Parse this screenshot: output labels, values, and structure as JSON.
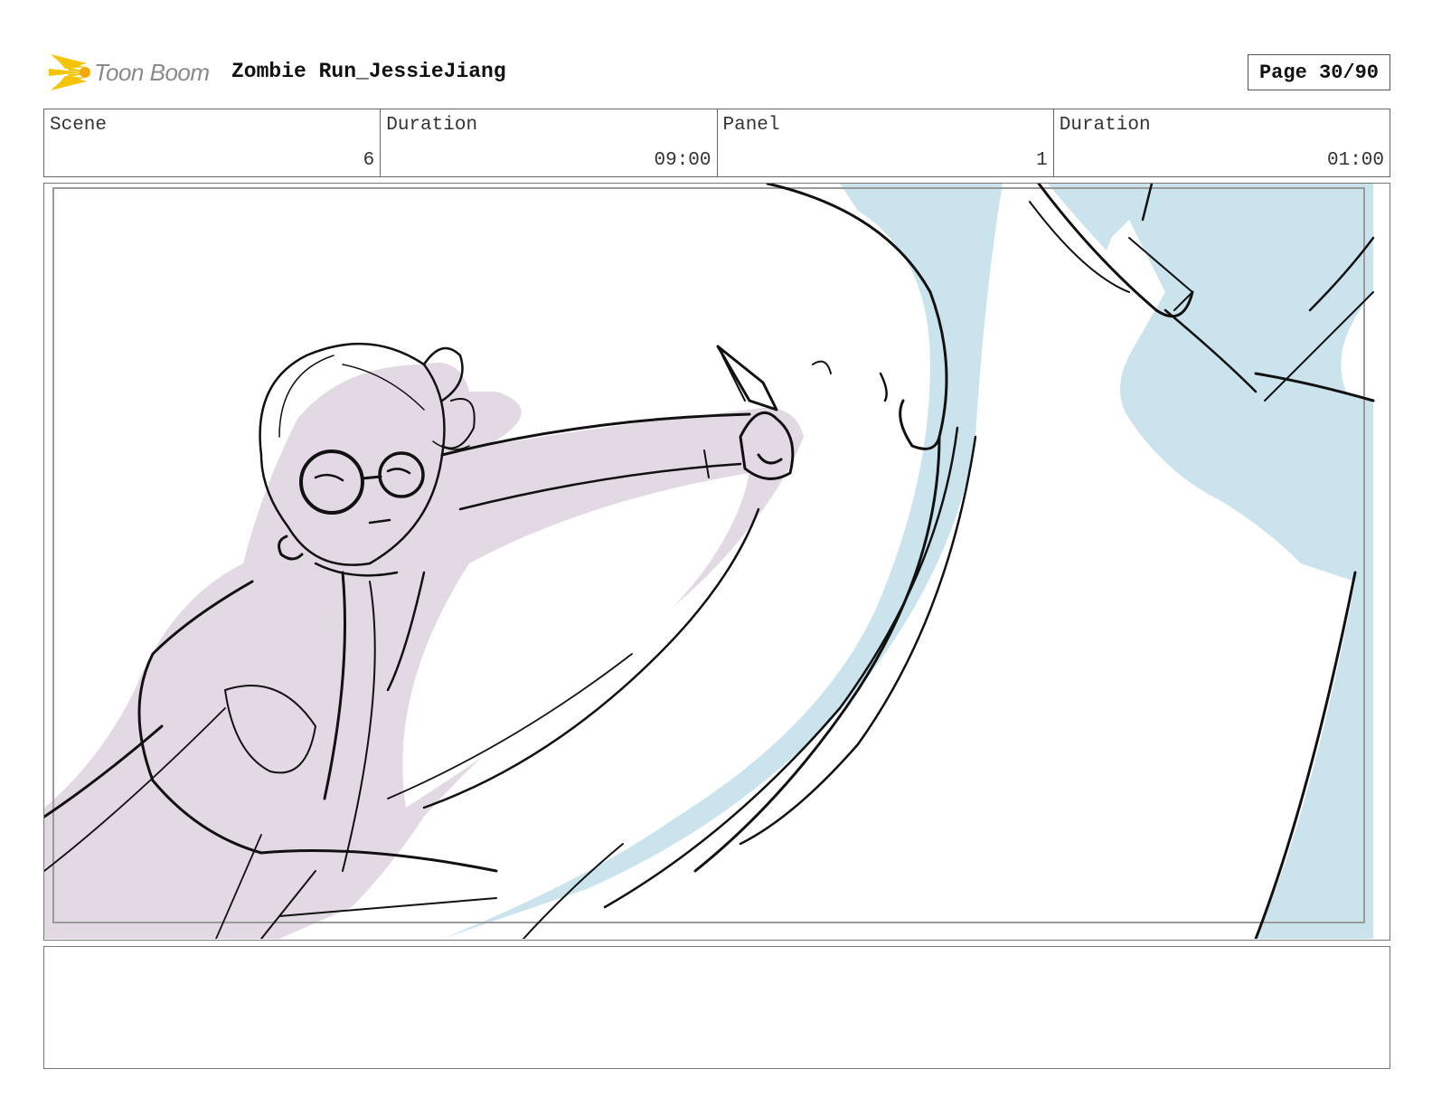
{
  "header": {
    "logo_text": "Toon Boom",
    "project_title": "Zombie Run_JessieJiang",
    "page_label": "Page 30/90"
  },
  "info": {
    "scene_label": "Scene",
    "scene_value": "6",
    "scene_duration_label": "Duration",
    "scene_duration_value": "09:00",
    "panel_label": "Panel",
    "panel_value": "1",
    "panel_duration_label": "Duration",
    "panel_duration_value": "01:00"
  },
  "colors": {
    "character_fill": "#e3d9e4",
    "zombie_fill": "#cae3ec",
    "logo_star": "#f5c400"
  },
  "notes": {
    "text": ""
  }
}
